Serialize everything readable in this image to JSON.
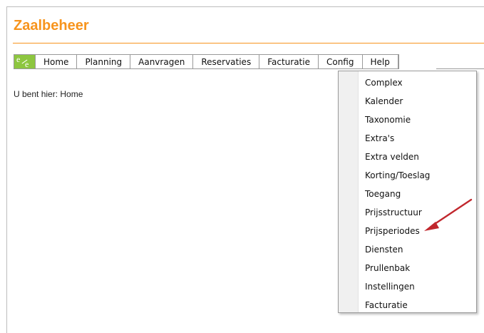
{
  "app": {
    "title": "Zaalbeheer"
  },
  "menu": {
    "items": [
      {
        "label": "Home"
      },
      {
        "label": "Planning"
      },
      {
        "label": "Aanvragen"
      },
      {
        "label": "Reservaties"
      },
      {
        "label": "Facturatie"
      },
      {
        "label": "Config"
      },
      {
        "label": "Help"
      }
    ],
    "active": "Config"
  },
  "breadcrumb": {
    "text": "U bent hier: Home"
  },
  "dropdown": {
    "items": [
      {
        "label": "Complex"
      },
      {
        "label": "Kalender"
      },
      {
        "label": "Taxonomie"
      },
      {
        "label": "Extra's"
      },
      {
        "label": "Extra velden"
      },
      {
        "label": "Korting/Toeslag"
      },
      {
        "label": "Toegang"
      },
      {
        "label": "Prijsstructuur"
      },
      {
        "label": "Prijsperiodes"
      },
      {
        "label": "Diensten"
      },
      {
        "label": "Prullenbak"
      },
      {
        "label": "Instellingen"
      },
      {
        "label": "Facturatie"
      }
    ]
  },
  "colors": {
    "brand": "#f7941d",
    "logo": "#8dc63f",
    "arrow": "#c1272d"
  },
  "icons": {
    "logo": "e2e-logo-icon",
    "annotation": "red-arrow-icon"
  }
}
